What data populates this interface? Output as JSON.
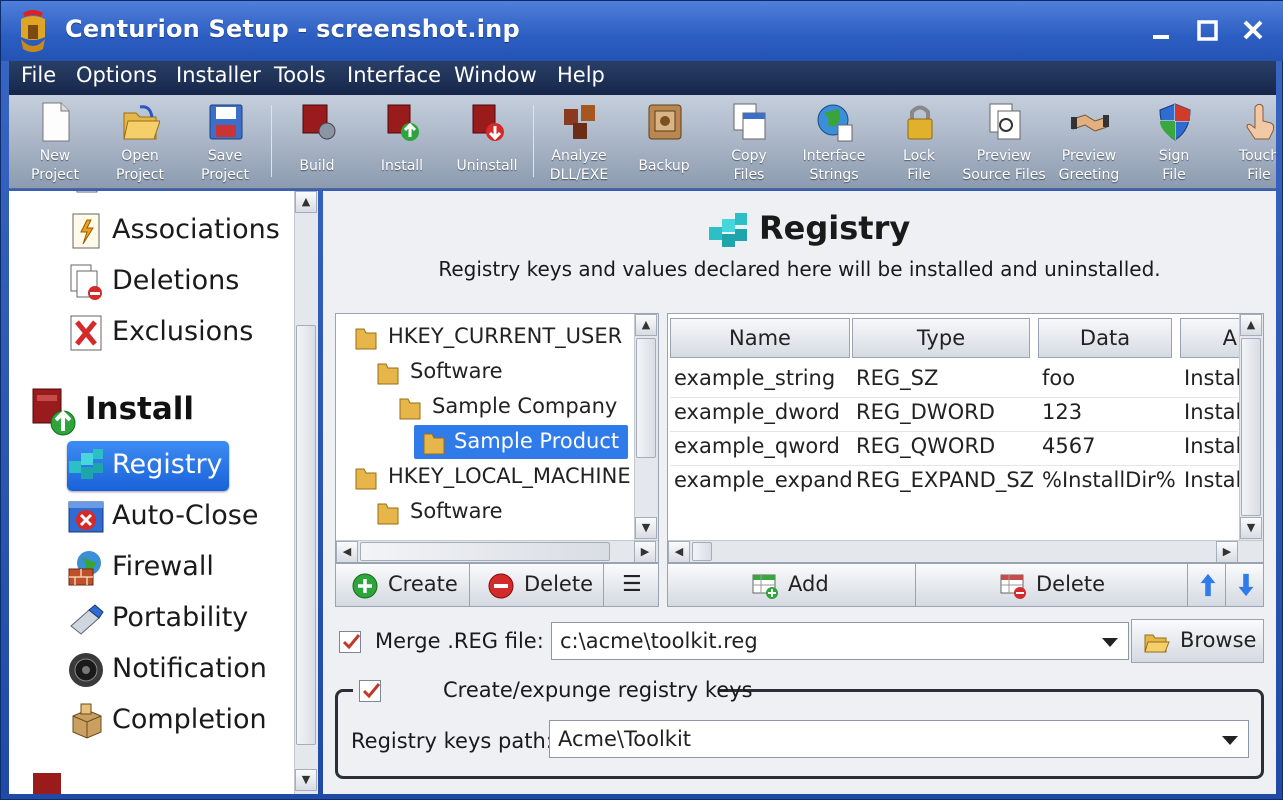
{
  "window": {
    "title": "Centurion Setup - screenshot.inp"
  },
  "menu": [
    "File",
    "Options",
    "Installer",
    "Tools",
    "Interface",
    "Window",
    "Help"
  ],
  "toolbar": [
    {
      "label": "New\nProject",
      "icon": "new-project-icon"
    },
    {
      "label": "Open\nProject",
      "icon": "open-project-icon"
    },
    {
      "label": "Save\nProject",
      "icon": "save-project-icon"
    },
    {
      "label": "Build",
      "icon": "build-icon"
    },
    {
      "label": "Install",
      "icon": "install-icon"
    },
    {
      "label": "Uninstall",
      "icon": "uninstall-icon"
    },
    {
      "label": "Analyze\nDLL/EXE",
      "icon": "analyze-icon"
    },
    {
      "label": "Backup",
      "icon": "backup-icon"
    },
    {
      "label": "Copy\nFiles",
      "icon": "copy-files-icon"
    },
    {
      "label": "Interface\nStrings",
      "icon": "globe-icon"
    },
    {
      "label": "Lock\nFile",
      "icon": "lock-icon"
    },
    {
      "label": "Preview\nSource Files",
      "icon": "preview-source-icon"
    },
    {
      "label": "Preview\nGreeting",
      "icon": "handshake-icon"
    },
    {
      "label": "Sign\nFile",
      "icon": "shield-icon"
    },
    {
      "label": "Touch\nFile",
      "icon": "touch-icon"
    }
  ],
  "sidebar": {
    "items_top": [
      "Associations",
      "Deletions",
      "Exclusions"
    ],
    "section": "Install",
    "items": [
      "Registry",
      "Auto-Close",
      "Firewall",
      "Portability",
      "Notification",
      "Completion"
    ],
    "selected": "Registry"
  },
  "page": {
    "title": "Registry",
    "subtitle": "Registry keys and values declared here will be installed and uninstalled."
  },
  "tree": {
    "nodes": [
      {
        "label": "HKEY_CURRENT_USER",
        "level": 0
      },
      {
        "label": "Software",
        "level": 1
      },
      {
        "label": "Sample Company",
        "level": 2
      },
      {
        "label": "Sample Product",
        "level": 3,
        "selected": true
      },
      {
        "label": "HKEY_LOCAL_MACHINE",
        "level": 0
      },
      {
        "label": "Software",
        "level": 1
      }
    ],
    "create_label": "Create",
    "delete_label": "Delete",
    "menu_glyph": "☰"
  },
  "values_grid": {
    "columns": [
      "Name",
      "Type",
      "Data",
      "A"
    ],
    "rows": [
      [
        "example_string",
        "REG_SZ",
        "foo",
        "Instal"
      ],
      [
        "example_dword",
        "REG_DWORD",
        "123",
        "Instal"
      ],
      [
        "example_qword",
        "REG_QWORD",
        "4567",
        "Instal"
      ],
      [
        "example_expand",
        "REG_EXPAND_SZ",
        "%InstallDir%",
        "Instal"
      ]
    ],
    "add_label": "Add",
    "delete_label": "Delete"
  },
  "merge": {
    "checked": true,
    "label": "Merge .REG file:",
    "value": "c:\\acme\\toolkit.reg",
    "browse_label": "Browse"
  },
  "expunge": {
    "checked": true,
    "label": "Create/expunge registry keys",
    "path_label": "Registry keys path:",
    "path_value": "Acme\\Toolkit"
  }
}
